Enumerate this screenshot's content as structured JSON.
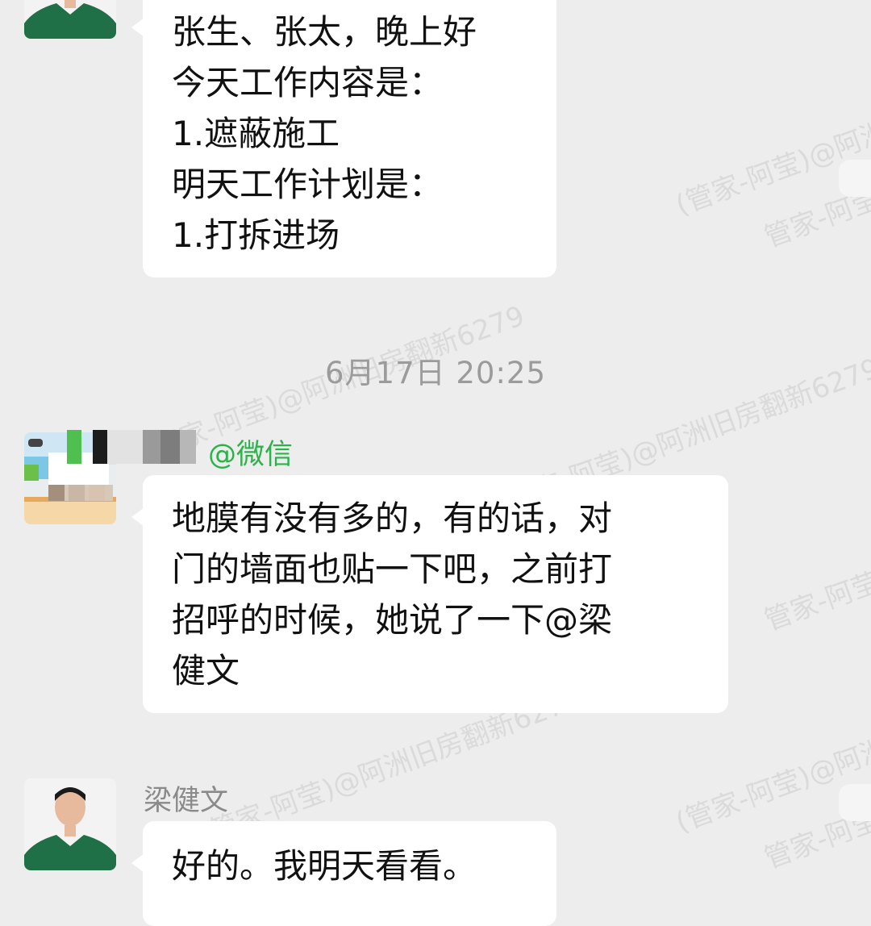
{
  "watermark": {
    "text_a": "(管家-阿莹)@阿洲旧房翻新6279",
    "text_b": "管家-阿莹"
  },
  "messages": [
    {
      "id": "msg1",
      "lines": [
        "张生、张太，晚上好",
        "今天工作内容是：",
        "1.遮蔽施工",
        "明天工作计划是：",
        "1.打拆进场"
      ]
    },
    {
      "id": "msg2",
      "sender_suffix": "@微信",
      "lines": [
        "地膜有没有多的，有的话，对",
        "门的墙面也贴一下吧，之前打",
        "招呼的时候，她说了一下@梁",
        "健文"
      ]
    },
    {
      "id": "msg3",
      "sender": "梁健文",
      "lines": [
        "好的。我明天看看。"
      ]
    }
  ],
  "timestamp": "6月17日  20:25",
  "colors": {
    "background": "#ededed",
    "bubble": "#ffffff",
    "wechat_green": "#2bb34a",
    "gray_text": "#9b9b9b"
  }
}
